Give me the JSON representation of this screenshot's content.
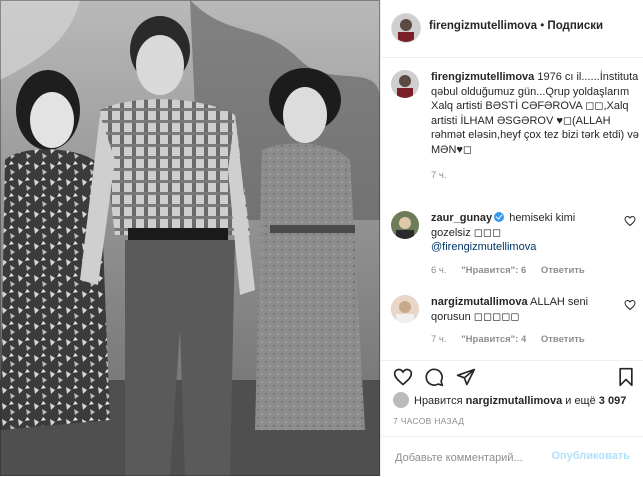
{
  "post": {
    "username": "firengizmutellimova",
    "separator": " • ",
    "follow_label": "Подписки",
    "caption_user": "firengizmutellimova",
    "caption": " 1976 cı il......İnstituta qəbul olduğumuz gün...Qrup yoldaşlarım Xalq artisti BƏSTİ CƏFƏROVA ◻◻,Xalq artisti İLHAM ƏSGƏROV ♥◻(ALLAH rəhmət eləsin,heyf çox tez bizi tərk etdi) və MƏN♥◻",
    "caption_time": "7 ч."
  },
  "comments": [
    {
      "user": "zaur_gunay",
      "verified": true,
      "text": " hemiseki kimi gozelsiz ◻◻◻",
      "mention": "@firengizmutellimova",
      "time": "6 ч.",
      "likes": "\"Нравится\": 6",
      "reply_label": "Ответить"
    },
    {
      "user": "nargizmutallimova",
      "verified": false,
      "text": " ALLAH seni qorusun ◻◻◻◻◻",
      "mention": "",
      "time": "7 ч.",
      "likes": "\"Нравится\": 4",
      "reply_label": "Ответить"
    }
  ],
  "likes_line": {
    "prefix": "Нравится ",
    "user": "nargizmutallimova",
    "middle": " и ещё ",
    "count": "3 097"
  },
  "timestamp": "7 ЧАСОВ НАЗАД",
  "composer": {
    "placeholder": "Добавьте комментарий...",
    "post_label": "Опубликовать"
  },
  "icons": {
    "like": "heart-icon",
    "comment": "comment-icon",
    "share": "share-icon",
    "save": "bookmark-icon",
    "comment_like": "heart-icon"
  },
  "colors": {
    "link": "#00376b",
    "muted": "#8e8e8e",
    "verified": "#3897f0",
    "post_button_disabled": "#b2dffc"
  }
}
